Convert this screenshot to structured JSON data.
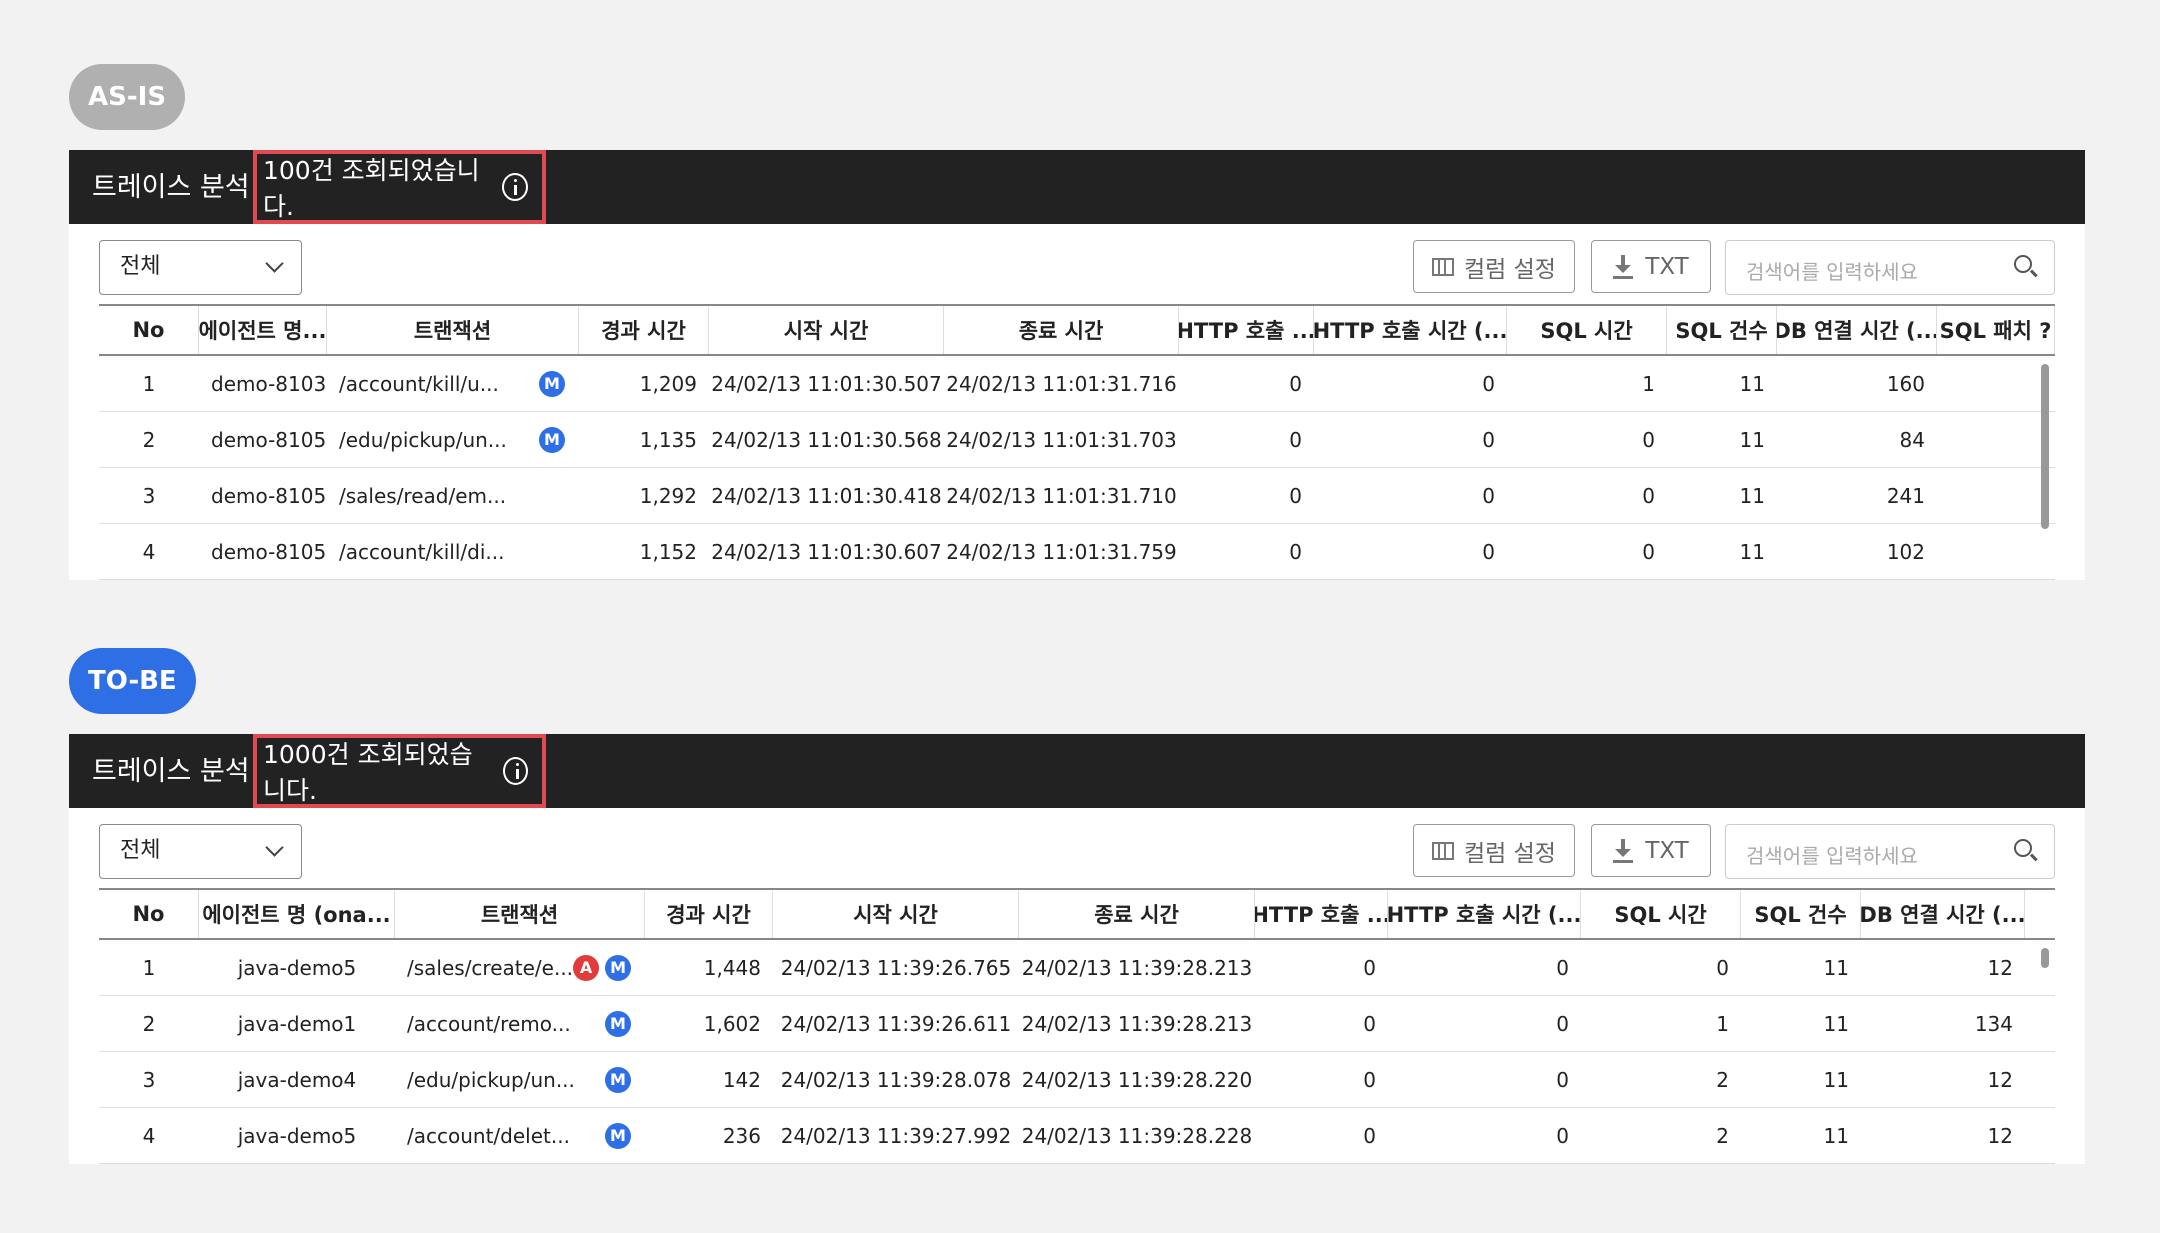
{
  "asis": {
    "badge": "AS-IS",
    "title": "트레이스 분석",
    "count_text": "100건 조회되었습니다.",
    "filter": "전체",
    "column_settings": "컬럼 설정",
    "txt": "TXT",
    "search_placeholder": "검색어를 입력하세요",
    "headers": [
      "No",
      "에이전트 명...",
      "트랜잭션",
      "경과 시간",
      "시작 시간",
      "종료 시간",
      "HTTP 호출 ...",
      "HTTP 호출 시간 (...",
      "SQL 시간",
      "SQL 건수",
      "DB 연결 시간 (...",
      "SQL 패치 ?"
    ],
    "rows": [
      {
        "no": "1",
        "agent": "demo-8103",
        "tx": "/account/kill/u...",
        "badge_a": false,
        "badge_m": true,
        "elapsed": "1,209",
        "start": "24/02/13 11:01:30.507",
        "end": "24/02/13 11:01:31.716",
        "http_calls": "0",
        "http_time": "0",
        "sql_time": "1",
        "sql_count": "11",
        "db_time": "160"
      },
      {
        "no": "2",
        "agent": "demo-8105",
        "tx": "/edu/pickup/un...",
        "badge_a": false,
        "badge_m": true,
        "elapsed": "1,135",
        "start": "24/02/13 11:01:30.568",
        "end": "24/02/13 11:01:31.703",
        "http_calls": "0",
        "http_time": "0",
        "sql_time": "0",
        "sql_count": "11",
        "db_time": "84"
      },
      {
        "no": "3",
        "agent": "demo-8105",
        "tx": "/sales/read/em...",
        "badge_a": false,
        "badge_m": false,
        "elapsed": "1,292",
        "start": "24/02/13 11:01:30.418",
        "end": "24/02/13 11:01:31.710",
        "http_calls": "0",
        "http_time": "0",
        "sql_time": "0",
        "sql_count": "11",
        "db_time": "241"
      },
      {
        "no": "4",
        "agent": "demo-8105",
        "tx": "/account/kill/di...",
        "badge_a": false,
        "badge_m": false,
        "elapsed": "1,152",
        "start": "24/02/13 11:01:30.607",
        "end": "24/02/13 11:01:31.759",
        "http_calls": "0",
        "http_time": "0",
        "sql_time": "0",
        "sql_count": "11",
        "db_time": "102"
      }
    ]
  },
  "tobe": {
    "badge": "TO-BE",
    "title": "트레이스 분석",
    "count_text": "1000건 조회되었습니다.",
    "filter": "전체",
    "column_settings": "컬럼 설정",
    "txt": "TXT",
    "search_placeholder": "검색어를 입력하세요",
    "headers": [
      "No",
      "에이전트 명 (ona...",
      "트랜잭션",
      "경과 시간",
      "시작 시간",
      "종료 시간",
      "HTTP 호출 ...",
      "HTTP 호출 시간 (...",
      "SQL 시간",
      "SQL 건수",
      "DB 연결 시간 (..."
    ],
    "rows": [
      {
        "no": "1",
        "agent": "java-demo5",
        "tx": "/sales/create/e...",
        "badge_a": true,
        "badge_m": true,
        "elapsed": "1,448",
        "start": "24/02/13 11:39:26.765",
        "end": "24/02/13 11:39:28.213",
        "http_calls": "0",
        "http_time": "0",
        "sql_time": "0",
        "sql_count": "11",
        "db_time": "12"
      },
      {
        "no": "2",
        "agent": "java-demo1",
        "tx": "/account/remo...",
        "badge_a": false,
        "badge_m": true,
        "elapsed": "1,602",
        "start": "24/02/13 11:39:26.611",
        "end": "24/02/13 11:39:28.213",
        "http_calls": "0",
        "http_time": "0",
        "sql_time": "1",
        "sql_count": "11",
        "db_time": "134"
      },
      {
        "no": "3",
        "agent": "java-demo4",
        "tx": "/edu/pickup/un...",
        "badge_a": false,
        "badge_m": true,
        "elapsed": "142",
        "start": "24/02/13 11:39:28.078",
        "end": "24/02/13 11:39:28.220",
        "http_calls": "0",
        "http_time": "0",
        "sql_time": "2",
        "sql_count": "11",
        "db_time": "12"
      },
      {
        "no": "4",
        "agent": "java-demo5",
        "tx": "/account/delet...",
        "badge_a": false,
        "badge_m": true,
        "elapsed": "236",
        "start": "24/02/13 11:39:27.992",
        "end": "24/02/13 11:39:28.228",
        "http_calls": "0",
        "http_time": "0",
        "sql_time": "2",
        "sql_count": "11",
        "db_time": "12"
      }
    ]
  },
  "badge_letters": {
    "a": "A",
    "m": "M"
  }
}
